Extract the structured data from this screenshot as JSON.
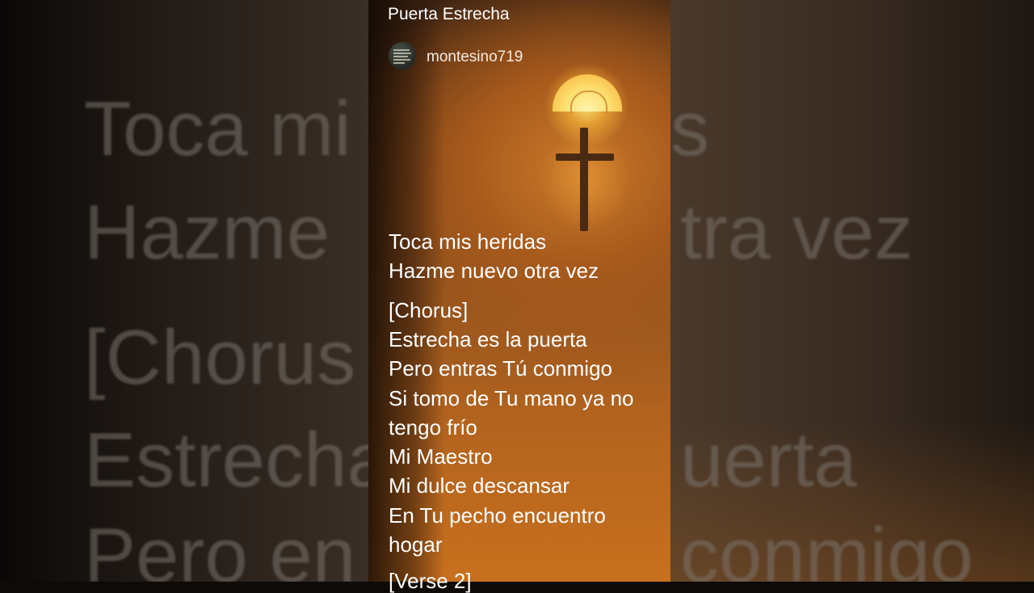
{
  "background_text": {
    "left": [
      "Toca mi",
      "Hazme",
      "[Chorus",
      "Estrecha",
      "Pero en"
    ],
    "right": [
      "s",
      "tra vez",
      "uerta",
      "conmigo"
    ]
  },
  "post": {
    "title": "Puerta Estrecha",
    "username": "montesino719"
  },
  "lyrics": [
    "Toca mis heridas",
    "Hazme nuevo otra vez",
    "[Chorus]",
    "Estrecha es la puerta",
    "Pero entras Tú conmigo",
    "Si tomo de Tu mano ya no",
    "tengo frío",
    "Mi Maestro",
    "Mi dulce descansar",
    "En Tu pecho encuentro",
    "hogar",
    "[Verse 2]"
  ],
  "colors": {
    "panel_orange": "#c8701e",
    "text": "#ffffff",
    "background_text": "#7a736c"
  }
}
